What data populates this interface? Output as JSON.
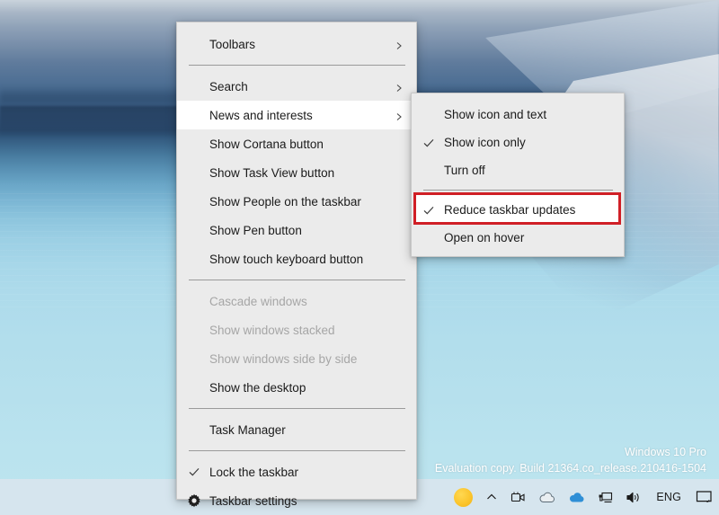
{
  "desktop": {
    "watermark_line1": "Windows 10 Pro",
    "watermark_line2": "Evaluation copy. Build 21364.co_release.210416-1504"
  },
  "taskbar": {
    "tray_icons": [
      {
        "name": "weather-sun-icon",
        "glyph": "sun"
      },
      {
        "name": "show-hidden-icons-chevron-icon",
        "glyph": "chevron-up"
      },
      {
        "name": "meet-now-camera-icon",
        "glyph": "camera"
      },
      {
        "name": "onedrive-gray-cloud-icon",
        "glyph": "cloud-gray"
      },
      {
        "name": "onedrive-blue-cloud-icon",
        "glyph": "cloud-blue"
      },
      {
        "name": "network-icon",
        "glyph": "network"
      },
      {
        "name": "volume-icon",
        "glyph": "speaker"
      }
    ],
    "language_label": "ENG",
    "action_center_name": "action-center-icon"
  },
  "context_menu": {
    "items": [
      {
        "id": "toolbars",
        "label": "Toolbars",
        "arrow": true,
        "checked": false,
        "disabled": false,
        "highlight": false
      },
      {
        "id": "separator-1",
        "label": "",
        "separator": true
      },
      {
        "id": "search",
        "label": "Search",
        "arrow": true,
        "checked": false,
        "disabled": false,
        "highlight": false
      },
      {
        "id": "news-and-interests",
        "label": "News and interests",
        "arrow": true,
        "checked": false,
        "disabled": false,
        "highlight": true
      },
      {
        "id": "show-cortana-button",
        "label": "Show Cortana button",
        "arrow": false,
        "checked": false,
        "disabled": false,
        "highlight": false
      },
      {
        "id": "show-task-view-button",
        "label": "Show Task View button",
        "arrow": false,
        "checked": false,
        "disabled": false,
        "highlight": false
      },
      {
        "id": "show-people",
        "label": "Show People on the taskbar",
        "arrow": false,
        "checked": false,
        "disabled": false,
        "highlight": false
      },
      {
        "id": "show-pen-button",
        "label": "Show Pen button",
        "arrow": false,
        "checked": false,
        "disabled": false,
        "highlight": false
      },
      {
        "id": "show-touch-keyboard",
        "label": "Show touch keyboard button",
        "arrow": false,
        "checked": false,
        "disabled": false,
        "highlight": false
      },
      {
        "id": "separator-2",
        "label": "",
        "separator": true
      },
      {
        "id": "cascade-windows",
        "label": "Cascade windows",
        "arrow": false,
        "checked": false,
        "disabled": true,
        "highlight": false
      },
      {
        "id": "show-windows-stacked",
        "label": "Show windows stacked",
        "arrow": false,
        "checked": false,
        "disabled": true,
        "highlight": false
      },
      {
        "id": "show-windows-side",
        "label": "Show windows side by side",
        "arrow": false,
        "checked": false,
        "disabled": true,
        "highlight": false
      },
      {
        "id": "show-the-desktop",
        "label": "Show the desktop",
        "arrow": false,
        "checked": false,
        "disabled": false,
        "highlight": false
      },
      {
        "id": "separator-3",
        "label": "",
        "separator": true
      },
      {
        "id": "task-manager",
        "label": "Task Manager",
        "arrow": false,
        "checked": false,
        "disabled": false,
        "highlight": false
      },
      {
        "id": "separator-4",
        "label": "",
        "separator": true
      },
      {
        "id": "lock-the-taskbar",
        "label": "Lock the taskbar",
        "arrow": false,
        "checked": true,
        "disabled": false,
        "highlight": false
      },
      {
        "id": "taskbar-settings",
        "label": "Taskbar settings",
        "arrow": false,
        "checked": false,
        "disabled": false,
        "highlight": false,
        "gear": true
      }
    ]
  },
  "submenu": {
    "items": [
      {
        "id": "show-icon-and-text",
        "label": "Show icon and text",
        "checked": false,
        "annotated": false
      },
      {
        "id": "show-icon-only",
        "label": "Show icon only",
        "checked": true,
        "annotated": false
      },
      {
        "id": "turn-off",
        "label": "Turn off",
        "checked": false,
        "annotated": false
      },
      {
        "id": "separator-1",
        "label": "",
        "separator": true
      },
      {
        "id": "reduce-taskbar-updates",
        "label": "Reduce taskbar updates",
        "checked": true,
        "annotated": true
      },
      {
        "id": "open-on-hover",
        "label": "Open on hover",
        "checked": false,
        "annotated": false
      }
    ]
  },
  "annotation": {
    "highlight_color": "#d01f26"
  }
}
